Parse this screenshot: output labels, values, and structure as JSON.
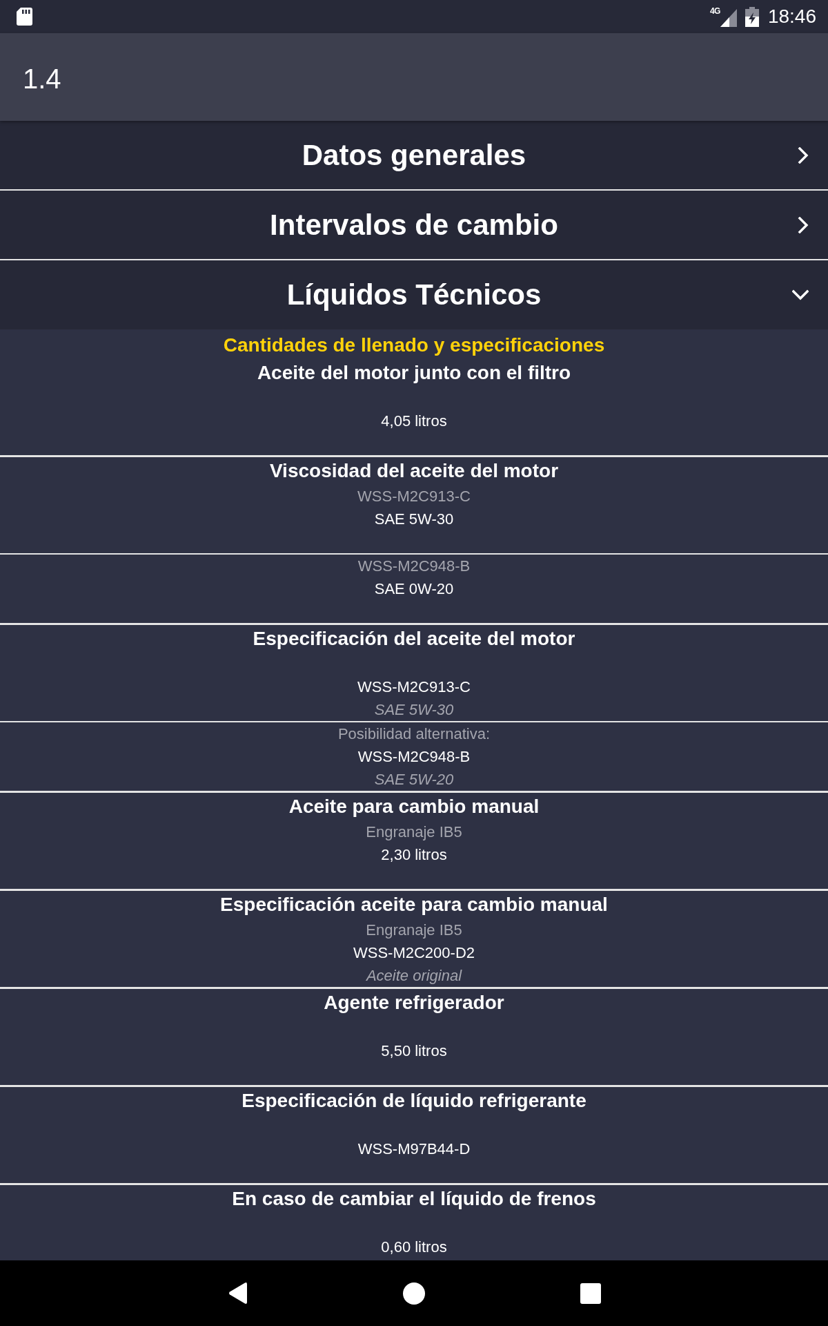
{
  "status_bar": {
    "network_type": "4G",
    "time": "18:46"
  },
  "app_bar": {
    "title": "1.4"
  },
  "sections": [
    {
      "title": "Datos generales",
      "expanded": false
    },
    {
      "title": "Intervalos de cambio",
      "expanded": false
    },
    {
      "title": "Líquidos Técnicos",
      "expanded": true,
      "subtitle": "Cantidades de llenado y especificaciones",
      "items": [
        {
          "title": "Aceite del motor junto con el filtro",
          "groups": [
            {
              "value": "4,05 litros"
            }
          ]
        },
        {
          "title": "Viscosidad del aceite del motor",
          "groups": [
            {
              "note": "WSS-M2C913-C",
              "value": "SAE 5W-30"
            },
            {
              "note": "WSS-M2C948-B",
              "value": "SAE 0W-20"
            }
          ]
        },
        {
          "title": "Especificación del aceite del motor",
          "groups": [
            {
              "value": "WSS-M2C913-C",
              "detail": "SAE 5W-30"
            },
            {
              "note": "Posibilidad alternativa:",
              "value": "WSS-M2C948-B",
              "detail": "SAE 5W-20"
            }
          ]
        },
        {
          "title": "Aceite para cambio manual",
          "groups": [
            {
              "note": "Engranaje IB5",
              "value": "2,30 litros"
            }
          ]
        },
        {
          "title": "Especificación aceite para cambio manual",
          "groups": [
            {
              "note": "Engranaje IB5",
              "value": "WSS-M2C200-D2",
              "detail": "Aceite original"
            }
          ]
        },
        {
          "title": "Agente refrigerador",
          "groups": [
            {
              "value": "5,50 litros"
            }
          ]
        },
        {
          "title": "Especificación de líquido refrigerante",
          "groups": [
            {
              "value": "WSS-M97B44-D"
            }
          ]
        },
        {
          "title": "En caso de cambiar el líquido de frenos",
          "groups": [
            {
              "value": "0,60 litros"
            }
          ]
        }
      ]
    }
  ]
}
